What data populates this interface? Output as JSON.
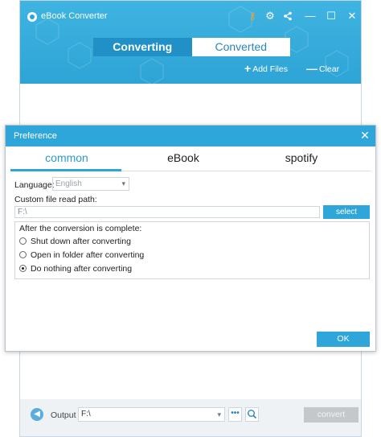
{
  "app": {
    "title": "eBook Converter",
    "tabs": [
      {
        "label": "Converting",
        "active": true
      },
      {
        "label": "Converted",
        "active": false
      }
    ],
    "add_files_label": "Add Files",
    "clear_label": "Clear",
    "window_icons": [
      "key-icon",
      "gear-icon",
      "share-icon",
      "minimize-icon",
      "maximize-icon",
      "close-icon"
    ]
  },
  "bottom": {
    "output_label": "Output",
    "output_path": "F:\\",
    "dots_label": "•••",
    "convert_label": "convert"
  },
  "dialog": {
    "title": "Preference",
    "tabs": [
      {
        "label": "common",
        "active": true
      },
      {
        "label": "eBook",
        "active": false
      },
      {
        "label": "spotify",
        "active": false
      }
    ],
    "language_label": "Language:",
    "language_value": "English",
    "custom_path_label": "Custom file read path:",
    "custom_path_value": "F:\\",
    "select_label": "select",
    "after_label": "After the conversion is complete:",
    "options": [
      {
        "label": "Shut down after converting",
        "selected": false
      },
      {
        "label": "Open in folder after converting",
        "selected": false
      },
      {
        "label": "Do nothing after converting",
        "selected": true
      }
    ],
    "ok_label": "OK"
  },
  "colors": {
    "accent": "#2ea6da",
    "tab_active": "#2190c6",
    "button_disabled": "#c4c8cb"
  }
}
